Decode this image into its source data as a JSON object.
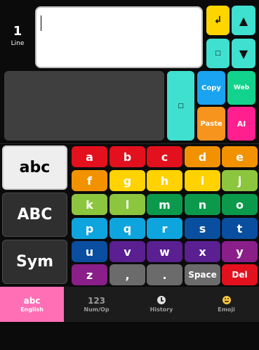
{
  "editor": {
    "line_count": "1",
    "line_label": "Line",
    "text": ""
  },
  "controls": {
    "enter": "↲",
    "up": "▲",
    "down": "▼",
    "small_square": "□",
    "mid_square": "□",
    "copy": "Copy",
    "web": "Web",
    "paste": "Paste",
    "ai": "AI"
  },
  "modes": [
    "abc",
    "ABC",
    "Sym"
  ],
  "keys": [
    {
      "label": "a",
      "color": "#e3101e"
    },
    {
      "label": "b",
      "color": "#e3101e"
    },
    {
      "label": "c",
      "color": "#e3101e"
    },
    {
      "label": "d",
      "color": "#f29200"
    },
    {
      "label": "e",
      "color": "#f29200"
    },
    {
      "label": "f",
      "color": "#f29200"
    },
    {
      "label": "g",
      "color": "#ffd200"
    },
    {
      "label": "h",
      "color": "#ffd200"
    },
    {
      "label": "i",
      "color": "#ffd200"
    },
    {
      "label": "j",
      "color": "#8cc63f"
    },
    {
      "label": "k",
      "color": "#8cc63f"
    },
    {
      "label": "l",
      "color": "#8cc63f"
    },
    {
      "label": "m",
      "color": "#0b9a4b"
    },
    {
      "label": "n",
      "color": "#0b9a4b"
    },
    {
      "label": "o",
      "color": "#0b9a4b"
    },
    {
      "label": "p",
      "color": "#0ea5df"
    },
    {
      "label": "q",
      "color": "#0ea5df"
    },
    {
      "label": "r",
      "color": "#0ea5df"
    },
    {
      "label": "s",
      "color": "#0a4ea0"
    },
    {
      "label": "t",
      "color": "#0a4ea0"
    },
    {
      "label": "u",
      "color": "#0a4ea0"
    },
    {
      "label": "v",
      "color": "#5a1f91"
    },
    {
      "label": "w",
      "color": "#5a1f91"
    },
    {
      "label": "x",
      "color": "#5a1f91"
    },
    {
      "label": "y",
      "color": "#8a1f8a"
    },
    {
      "label": "z",
      "color": "#8a1f8a"
    },
    {
      "label": ",",
      "color": "#6b6b6b"
    },
    {
      "label": ".",
      "color": "#6b6b6b"
    },
    {
      "label": "Space",
      "color": "#6b6b6b"
    },
    {
      "label": "Del",
      "color": "#e3101e"
    }
  ],
  "tabs": [
    {
      "title": "abc",
      "subtitle": "English"
    },
    {
      "title": "123",
      "subtitle": "Num/Op"
    },
    {
      "title": "",
      "subtitle": "History",
      "icon": "clock-icon"
    },
    {
      "title": "",
      "subtitle": "Emoji",
      "icon": "emoji-icon"
    }
  ]
}
